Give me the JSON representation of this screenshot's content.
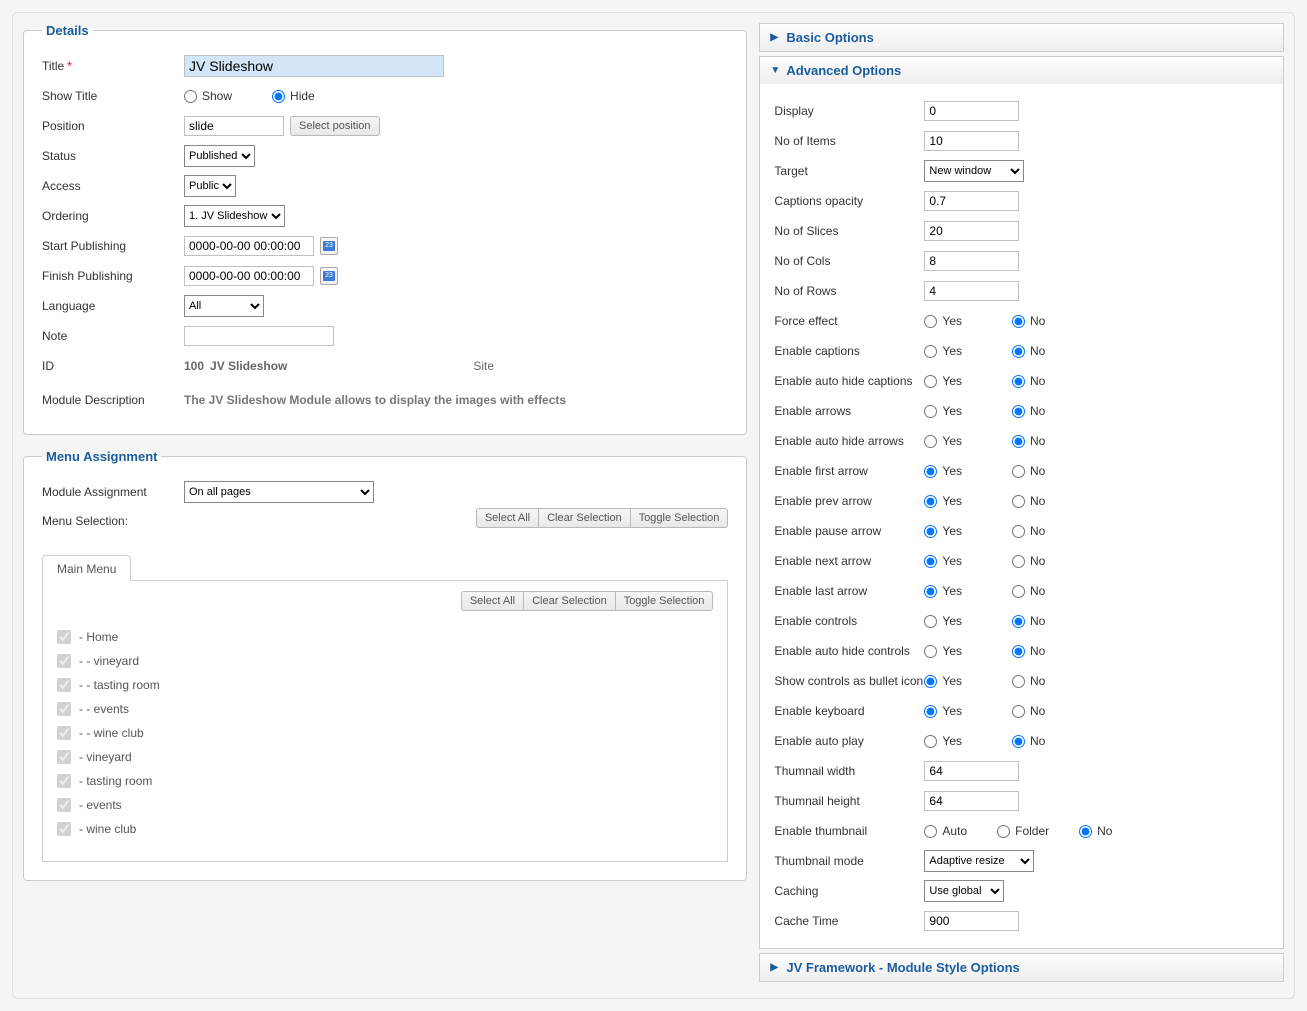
{
  "details": {
    "legend": "Details",
    "title_label": "Title",
    "title_value": "JV Slideshow",
    "show_title_label": "Show Title",
    "show_title_options": [
      "Show",
      "Hide"
    ],
    "show_title_selected": "Hide",
    "position_label": "Position",
    "position_value": "slide",
    "select_position_btn": "Select position",
    "status_label": "Status",
    "status_value": "Published",
    "access_label": "Access",
    "access_value": "Public",
    "ordering_label": "Ordering",
    "ordering_value": "1. JV Slideshow",
    "start_publishing_label": "Start Publishing",
    "start_publishing_value": "0000-00-00 00:00:00",
    "finish_publishing_label": "Finish Publishing",
    "finish_publishing_value": "0000-00-00 00:00:00",
    "calendar_day": "23",
    "language_label": "Language",
    "language_value": "All",
    "note_label": "Note",
    "note_value": "",
    "id_label": "ID",
    "id_value": "100",
    "id_name": "JV Slideshow",
    "id_client": "Site",
    "module_desc_label": "Module Description",
    "module_desc_value": "The JV Slideshow Module allows to display the images with effects"
  },
  "menu_assignment": {
    "legend": "Menu Assignment",
    "module_assignment_label": "Module Assignment",
    "module_assignment_value": "On all pages",
    "menu_selection_label": "Menu Selection:",
    "actions": [
      "Select All",
      "Clear Selection",
      "Toggle Selection"
    ],
    "tab_label": "Main Menu",
    "items": [
      "- Home",
      "- - vineyard",
      "- - tasting room",
      "- - events",
      "- - wine club",
      "- vineyard",
      "- tasting room",
      "- events",
      "- wine club"
    ]
  },
  "right": {
    "basic_title": "Basic Options",
    "advanced_title": "Advanced Options",
    "framework_title": "JV Framework - Module Style Options",
    "yes": "Yes",
    "no": "No",
    "auto": "Auto",
    "folder": "Folder",
    "fields": {
      "display": {
        "label": "Display",
        "value": "0"
      },
      "no_items": {
        "label": "No of Items",
        "value": "10"
      },
      "target": {
        "label": "Target",
        "value": "New window"
      },
      "captions_opacity": {
        "label": "Captions opacity",
        "value": "0.7"
      },
      "no_slices": {
        "label": "No of Slices",
        "value": "20"
      },
      "no_cols": {
        "label": "No of Cols",
        "value": "8"
      },
      "no_rows": {
        "label": "No of Rows",
        "value": "4"
      },
      "force_effect": {
        "label": "Force effect",
        "selected": "No"
      },
      "enable_captions": {
        "label": "Enable captions",
        "selected": "No"
      },
      "enable_auto_hide_captions": {
        "label": "Enable auto hide captions",
        "selected": "No"
      },
      "enable_arrows": {
        "label": "Enable arrows",
        "selected": "No"
      },
      "enable_auto_hide_arrows": {
        "label": "Enable auto hide arrows",
        "selected": "No"
      },
      "enable_first_arrow": {
        "label": "Enable first arrow",
        "selected": "Yes"
      },
      "enable_prev_arrow": {
        "label": "Enable prev arrow",
        "selected": "Yes"
      },
      "enable_pause_arrow": {
        "label": "Enable pause arrow",
        "selected": "Yes"
      },
      "enable_next_arrow": {
        "label": "Enable next arrow",
        "selected": "Yes"
      },
      "enable_last_arrow": {
        "label": "Enable last arrow",
        "selected": "Yes"
      },
      "enable_controls": {
        "label": "Enable controls",
        "selected": "No"
      },
      "enable_auto_hide_controls": {
        "label": "Enable auto hide controls",
        "selected": "No"
      },
      "show_controls_bullet": {
        "label": "Show controls as bullet icon",
        "selected": "Yes"
      },
      "enable_keyboard": {
        "label": "Enable keyboard",
        "selected": "Yes"
      },
      "enable_auto_play": {
        "label": "Enable auto play",
        "selected": "No"
      },
      "thumb_width": {
        "label": "Thumnail width",
        "value": "64"
      },
      "thumb_height": {
        "label": "Thumnail height",
        "value": "64"
      },
      "enable_thumbnail": {
        "label": "Enable thumbnail",
        "selected": "No"
      },
      "thumbnail_mode": {
        "label": "Thumbnail mode",
        "value": "Adaptive resize"
      },
      "caching": {
        "label": "Caching",
        "value": "Use global"
      },
      "cache_time": {
        "label": "Cache Time",
        "value": "900"
      }
    }
  }
}
